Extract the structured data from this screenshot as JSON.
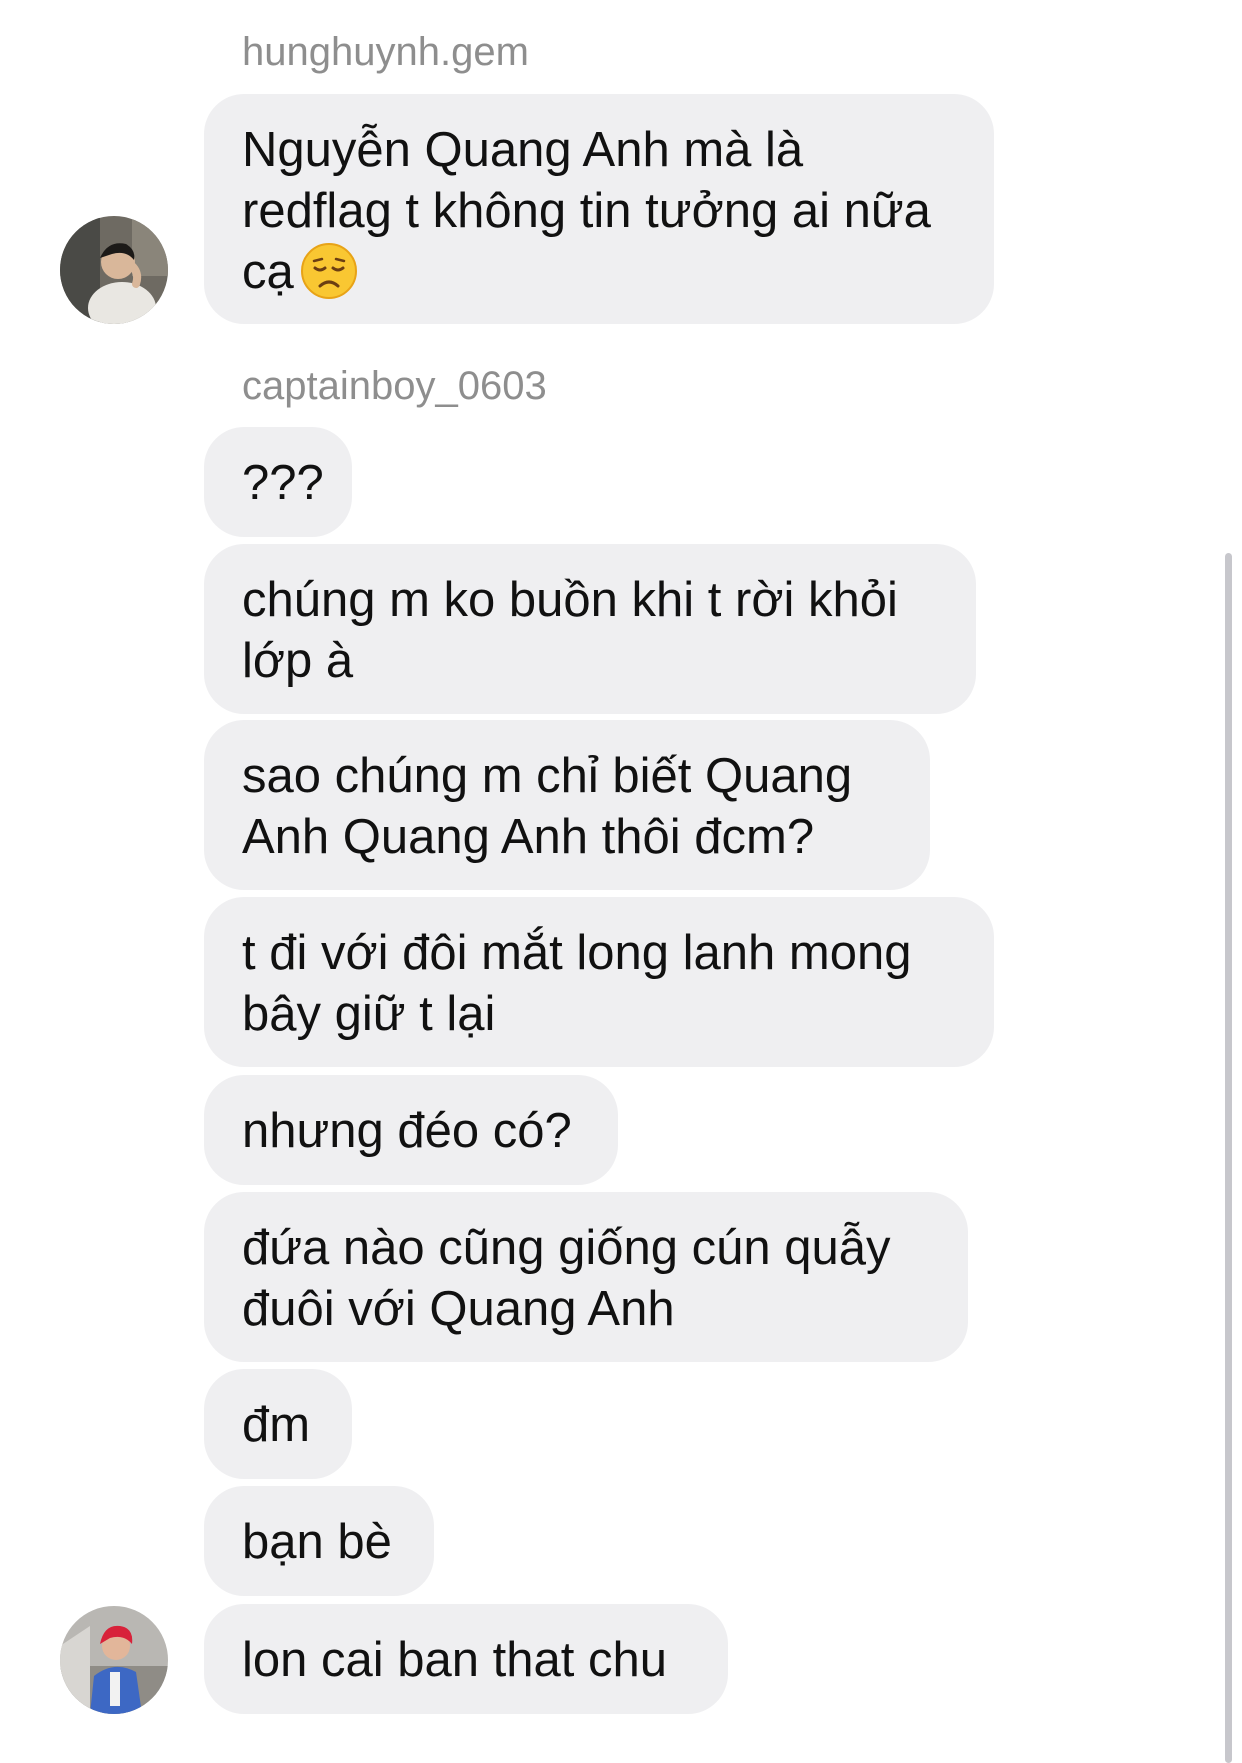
{
  "thread": {
    "groups": [
      {
        "sender": "hunghuynh.gem",
        "avatar_icon": "profile-photo-avatar",
        "messages": [
          {
            "line1": "Nguyễn Quang Anh mà là",
            "line2": "redflag t không tin tưởng ai nữa",
            "line3": "cạ",
            "emoji": "disappointed-face-emoji"
          }
        ]
      },
      {
        "sender": "captainboy_0603",
        "avatar_icon": "profile-photo-avatar",
        "messages": [
          {
            "line1": "???"
          },
          {
            "line1": "chúng m ko buồn khi t rời khỏi",
            "line2": "lớp à"
          },
          {
            "line1": "sao chúng m chỉ biết Quang",
            "line2": "Anh Quang Anh thôi đcm?"
          },
          {
            "line1": "t đi với đôi mắt long lanh mong",
            "line2": "bây giữ t lại"
          },
          {
            "line1": "nhưng đéo có?"
          },
          {
            "line1": "đứa nào cũng giống cún quẫy",
            "line2": "đuôi với Quang Anh"
          },
          {
            "line1": "đm"
          },
          {
            "line1": "bạn bè"
          },
          {
            "line1": "lon cai ban that chu"
          }
        ]
      }
    ]
  },
  "colors": {
    "bubble": "#efeff1",
    "text": "#111111",
    "sender": "#8e8e8e",
    "background": "#ffffff"
  }
}
